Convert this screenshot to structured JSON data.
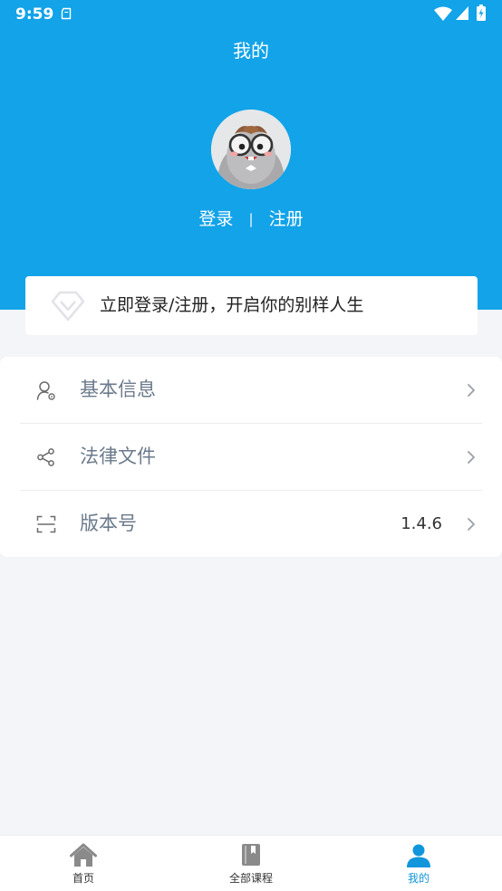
{
  "status_bar": {
    "time": "9:59"
  },
  "header": {
    "title": "我的",
    "login_label": "登录",
    "separator": "|",
    "register_label": "注册"
  },
  "promo": {
    "text": "立即登录/注册，开启你的别样人生"
  },
  "menu": {
    "items": [
      {
        "label": "基本信息",
        "icon": "user-settings-icon",
        "value": ""
      },
      {
        "label": "法律文件",
        "icon": "share-icon",
        "value": ""
      },
      {
        "label": "版本号",
        "icon": "scan-frame-icon",
        "value": "1.4.6"
      }
    ]
  },
  "tabs": [
    {
      "label": "首页",
      "icon": "home-icon",
      "active": false
    },
    {
      "label": "全部课程",
      "icon": "book-icon",
      "active": false
    },
    {
      "label": "我的",
      "icon": "person-icon",
      "active": true
    }
  ],
  "colors": {
    "primary": "#12a3e8",
    "active_tab": "#1296db",
    "inactive_icon": "#8a8a8a",
    "menu_label": "#6b7a8c",
    "background": "#f4f5f8"
  }
}
